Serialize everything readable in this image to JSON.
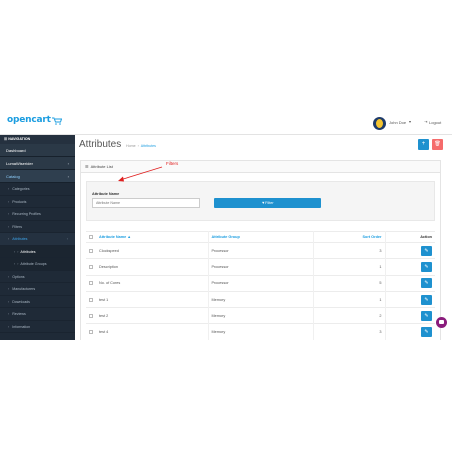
{
  "header": {
    "logo_text": "opencart",
    "user_name": "John Doe",
    "user_caret": "▾",
    "logout_label": "Logout"
  },
  "sidebar": {
    "nav_heading": "NAVIGATION",
    "items": [
      {
        "label": "Dashboard"
      },
      {
        "label": "LumaWiserider",
        "caret": "›"
      },
      {
        "label": "Catalog",
        "caret": "›"
      }
    ],
    "catalog_children": [
      {
        "label": "Categories"
      },
      {
        "label": "Products"
      },
      {
        "label": "Recurring Profiles"
      },
      {
        "label": "Filters"
      },
      {
        "label": "Attributes",
        "caret": "›"
      }
    ],
    "attribute_children": [
      {
        "label": "Attributes"
      },
      {
        "label": "Attribute Groups"
      }
    ],
    "more_children": [
      {
        "label": "Options"
      },
      {
        "label": "Manufacturers"
      },
      {
        "label": "Downloads"
      },
      {
        "label": "Reviews"
      },
      {
        "label": "Information"
      }
    ],
    "arrow_glyph": "›"
  },
  "page": {
    "title": "Attributes",
    "breadcrumb": [
      "Home",
      "Attributes"
    ],
    "breadcrumb_sep": "›",
    "add_button_icon": "+",
    "delete_button_icon": "🗑"
  },
  "panel": {
    "heading": "Attribute List",
    "annotation": "Filters",
    "filter_label": "Attribute Name",
    "filter_placeholder": "Attribute Name",
    "filter_button": "▼Filter"
  },
  "table": {
    "headers": [
      "Attribute Name ▲",
      "Attribute Group",
      "Sort Order",
      "Action"
    ],
    "rows": [
      {
        "name": "Clockspeed",
        "group": "Processor",
        "sort": "3"
      },
      {
        "name": "Description",
        "group": "Processor",
        "sort": "1"
      },
      {
        "name": "No. of Cores",
        "group": "Processor",
        "sort": "5"
      },
      {
        "name": "test 1",
        "group": "Memory",
        "sort": "1"
      },
      {
        "name": "test 2",
        "group": "Memory",
        "sort": "2"
      },
      {
        "name": "test 4",
        "group": "Memory",
        "sort": "3"
      }
    ],
    "edit_icon": "✎"
  },
  "colors": {
    "brand": "#1b9de0",
    "primary_button": "#1e91cf",
    "danger_button": "#f56b6b",
    "sidebar_bg": "#1f2a37",
    "annotation": "#e02020"
  }
}
